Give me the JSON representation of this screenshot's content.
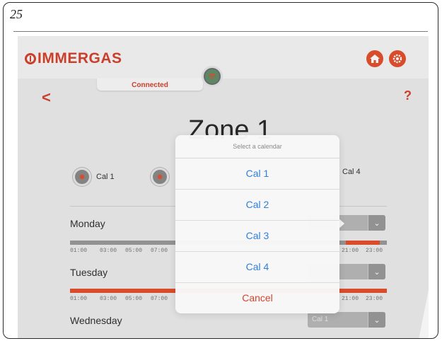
{
  "figure_number": "25",
  "header": {
    "logo_text": "IMMERGAS",
    "home_icon": "home-icon",
    "settings_icon": "gear-icon",
    "accent_color": "#e4512f"
  },
  "connection": {
    "label": "Connected",
    "icon": "wifi-icon"
  },
  "nav": {
    "back_glyph": "<",
    "help_glyph": "?"
  },
  "zone": {
    "title": "Zone 1"
  },
  "calendars": [
    {
      "label": "Cal 1"
    },
    {
      "label": "Cal 4"
    }
  ],
  "schedule": [
    {
      "day": "Monday",
      "selected": "",
      "bar_color": "#9a9a9a"
    },
    {
      "day": "Tuesday",
      "selected": "",
      "bar_color": "#e4512f"
    },
    {
      "day": "Wednesday",
      "selected": "Cal 1",
      "bar_color": "#e4512f"
    }
  ],
  "ticks_left": [
    "01:00",
    "03:00",
    "05:00",
    "07:00"
  ],
  "ticks_right": [
    "21:00",
    "23:00"
  ],
  "popover": {
    "title": "Select a calendar",
    "options": [
      "Cal 1",
      "Cal 2",
      "Cal 3",
      "Cal 4"
    ],
    "cancel": "Cancel"
  }
}
